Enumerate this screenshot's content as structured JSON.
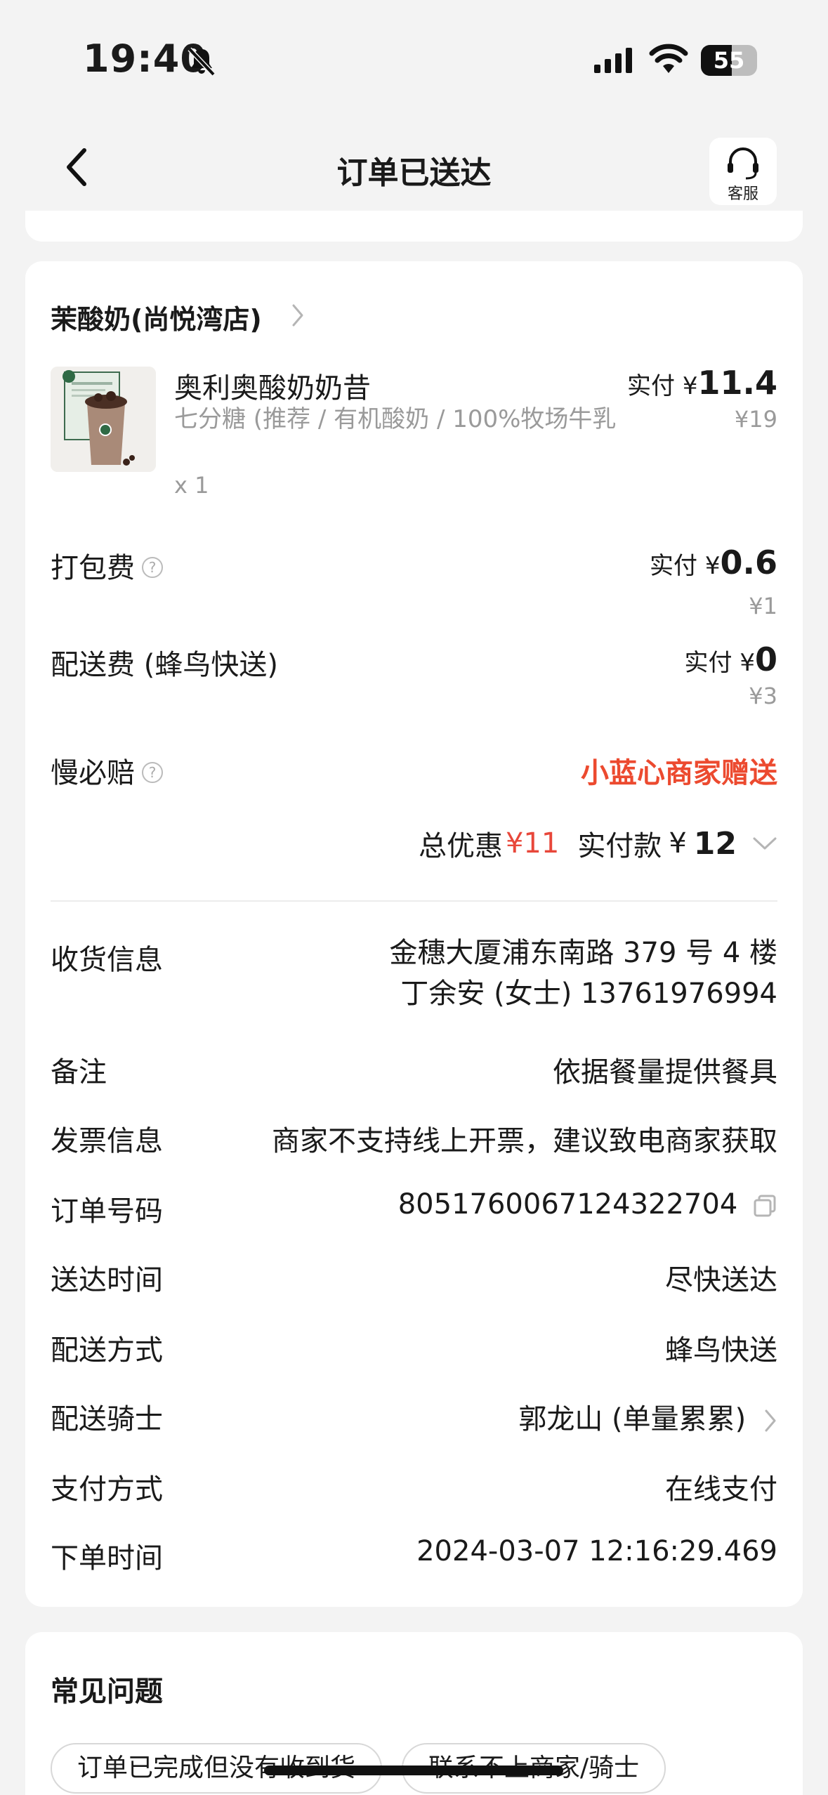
{
  "status_bar": {
    "time": "19:40",
    "battery": "55"
  },
  "header": {
    "title": "订单已送达",
    "service_label": "客服"
  },
  "shop": {
    "name": "茉酸奶(尚悦湾店)"
  },
  "product": {
    "name": "奥利奥酸奶奶昔",
    "spec": "七分糖 (推荐 / 有机酸奶 / 100%牧场牛乳",
    "qty": "x 1",
    "paid_prefix": "实付 ¥",
    "paid_amount": "11.4",
    "original": "¥19"
  },
  "fees": {
    "packing_label": "打包费",
    "packing_paid_prefix": "实付 ¥",
    "packing_paid": "0.6",
    "packing_original": "¥1",
    "delivery_label": "配送费 (蜂鸟快送)",
    "delivery_paid_prefix": "实付 ¥",
    "delivery_paid": "0",
    "delivery_original": "¥3",
    "slow_label": "慢必赔",
    "slow_value": "小蓝心商家赠送"
  },
  "summary": {
    "discount_label": "总优惠",
    "discount_value": "¥11",
    "paid_label": "实付款",
    "paid_symbol": "¥",
    "paid_value": "12"
  },
  "info": {
    "address_label": "收货信息",
    "address_line1": "金穗大厦浦东南路 379 号 4 楼",
    "address_line2": "丁余安 (女士) 13761976994",
    "remark_label": "备注",
    "remark_value": "依据餐量提供餐具",
    "invoice_label": "发票信息",
    "invoice_value": "商家不支持线上开票，建议致电商家获取",
    "order_no_label": "订单号码",
    "order_no_value": "8051760067124322704",
    "delivery_time_label": "送达时间",
    "delivery_time_value": "尽快送达",
    "delivery_method_label": "配送方式",
    "delivery_method_value": "蜂鸟快送",
    "rider_label": "配送骑士",
    "rider_value": "郭龙山 (单量累累)",
    "payment_label": "支付方式",
    "payment_value": "在线支付",
    "order_time_label": "下单时间",
    "order_time_value": "2024-03-07 12:16:29.469"
  },
  "faq": {
    "title": "常见问题",
    "chips": [
      "订单已完成但没有收到货",
      "联系不上商家/骑士"
    ]
  }
}
